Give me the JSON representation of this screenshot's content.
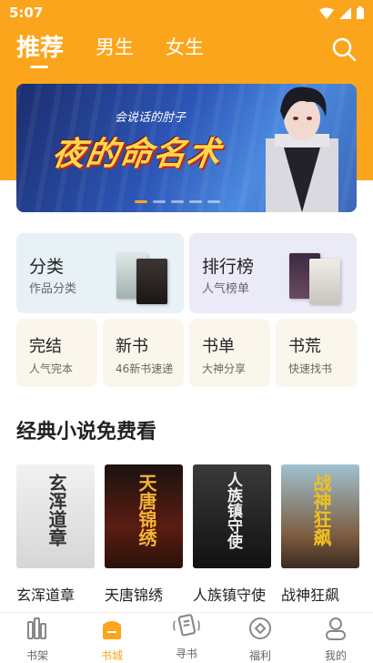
{
  "status_bar": {
    "time": "5:07"
  },
  "tabs": [
    {
      "label": "推荐",
      "active": true
    },
    {
      "label": "男生",
      "active": false
    },
    {
      "label": "女生",
      "active": false
    }
  ],
  "banner": {
    "author": "会说话的肘子",
    "title": "夜的命名术",
    "dot_count": 5,
    "active_dot": 0
  },
  "categories_large": [
    {
      "title": "分类",
      "subtitle": "作品分类"
    },
    {
      "title": "排行榜",
      "subtitle": "人气榜单"
    }
  ],
  "categories_small": [
    {
      "title": "完结",
      "subtitle": "人气完本"
    },
    {
      "title": "新书",
      "subtitle": "46新书速递"
    },
    {
      "title": "书单",
      "subtitle": "大神分享"
    },
    {
      "title": "书荒",
      "subtitle": "快速找书"
    }
  ],
  "section": {
    "title": "经典小说免费看"
  },
  "books": [
    {
      "name": "玄浑道章",
      "cover_text": "玄浑道章"
    },
    {
      "name": "天唐锦绣",
      "cover_text": "天唐锦绣"
    },
    {
      "name": "人族镇守使",
      "cover_text": "人族镇守使"
    },
    {
      "name": "战神狂飙",
      "cover_text": "战神狂飙"
    }
  ],
  "bottom_nav": [
    {
      "label": "书架",
      "icon": "bookshelf-icon",
      "active": false
    },
    {
      "label": "书城",
      "icon": "bookstore-icon",
      "active": true
    },
    {
      "label": "寻书",
      "icon": "find-book-icon",
      "active": false
    },
    {
      "label": "福利",
      "icon": "welfare-icon",
      "active": false
    },
    {
      "label": "我的",
      "icon": "profile-icon",
      "active": false
    }
  ],
  "colors": {
    "accent": "#fba51c",
    "card_blue": "#e7f1f6",
    "card_purple": "#ebeaf7",
    "card_cream": "#fbf6ec"
  }
}
